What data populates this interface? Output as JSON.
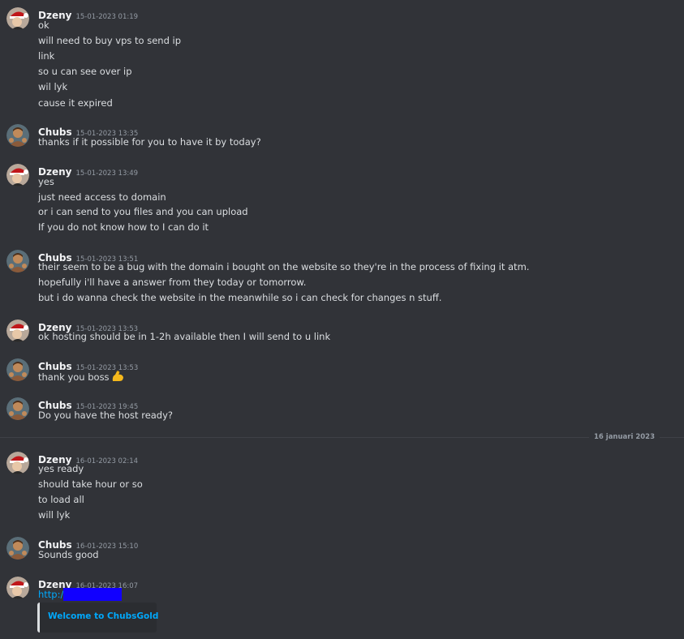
{
  "messages": [
    {
      "author": "Dzeny",
      "timestamp": "15-01-2023 01:19",
      "lines": [
        "ok",
        "will need to buy vps to send ip",
        "link",
        "so u can see over ip",
        "wil lyk",
        "cause it expired"
      ]
    },
    {
      "author": "Chubs",
      "timestamp": "15-01-2023 13:35",
      "lines": [
        "thanks if it possible for you to have it by today?"
      ]
    },
    {
      "author": "Dzeny",
      "timestamp": "15-01-2023 13:49",
      "lines": [
        "yes",
        "just need access to domain",
        "or i can send to you files and you can upload",
        "If you do not know how to I can do it"
      ]
    },
    {
      "author": "Chubs",
      "timestamp": "15-01-2023 13:51",
      "lines": [
        "their seem to be a bug with the domain i bought on the website so they're in the process of fixing it atm.",
        "hopefully i'll have a answer from they today or tomorrow.",
        "but i do wanna check the website in the meanwhile so i can check for changes n stuff."
      ]
    },
    {
      "author": "Dzeny",
      "timestamp": "15-01-2023 13:53",
      "lines": [
        "ok hosting should be in 1-2h available then I will send to u link"
      ]
    },
    {
      "author": "Chubs",
      "timestamp": "15-01-2023 13:53",
      "lines": [
        "thank you boss"
      ],
      "emoji": "flexed-biceps-emoji"
    },
    {
      "author": "Chubs",
      "timestamp": "15-01-2023 19:45",
      "lines": [
        "Do you have the host ready?"
      ]
    },
    {
      "author": "Dzeny",
      "timestamp": "16-01-2023 02:14",
      "lines": [
        "yes ready",
        "should take hour or so",
        "to load all",
        "will lyk"
      ]
    },
    {
      "author": "Chubs",
      "timestamp": "16-01-2023 15:10",
      "lines": [
        "Sounds good"
      ]
    },
    {
      "author": "Dzeny",
      "timestamp": "16-01-2023 16:07",
      "link_prefix": "http:/",
      "embed_title": "Welcome to ChubsGold"
    }
  ],
  "date_divider": "16 januari 2023",
  "colors": {
    "background": "#313338",
    "link": "#00a8fc",
    "redaction": "#1100ff",
    "embed_bg": "#2b2d31"
  }
}
